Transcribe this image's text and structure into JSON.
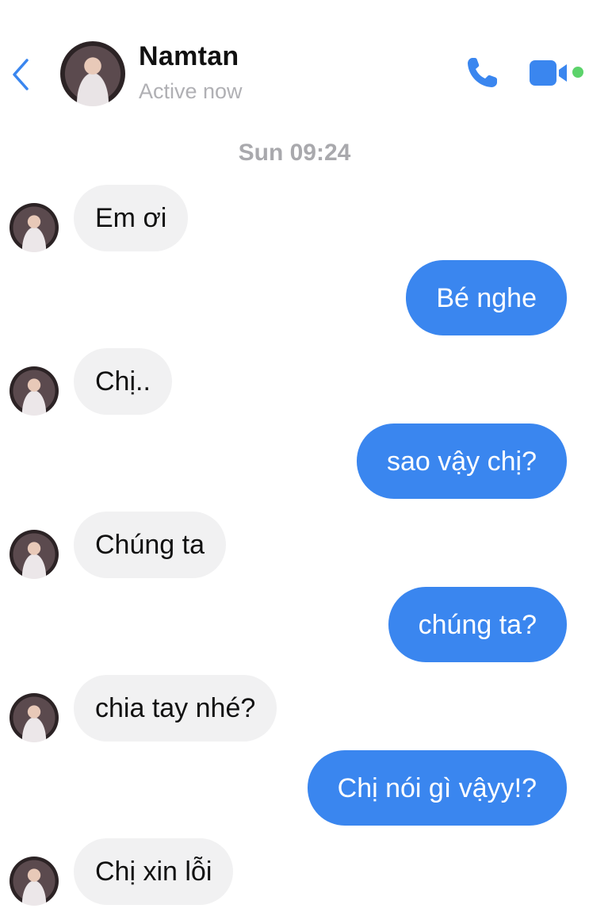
{
  "header": {
    "contact_name": "Namtan",
    "status": "Active now",
    "accent_color": "#3a86ef",
    "online_color": "#5cd36b",
    "icons": [
      "chevron-left-icon",
      "phone-icon",
      "video-camera-icon"
    ]
  },
  "conversation": {
    "timestamp": "Sun 09:24",
    "messages": [
      {
        "sender": "contact",
        "text": "Em ơi"
      },
      {
        "sender": "me",
        "text": "Bé nghe"
      },
      {
        "sender": "contact",
        "text": "Chị.."
      },
      {
        "sender": "me",
        "text": "sao vậy chị?"
      },
      {
        "sender": "contact",
        "text": "Chúng ta"
      },
      {
        "sender": "me",
        "text": "chúng ta?"
      },
      {
        "sender": "contact",
        "text": "chia tay nhé?"
      },
      {
        "sender": "me",
        "text": "Chị nói gì vậyy!?"
      },
      {
        "sender": "contact",
        "text": "Chị xin lỗi"
      }
    ]
  }
}
